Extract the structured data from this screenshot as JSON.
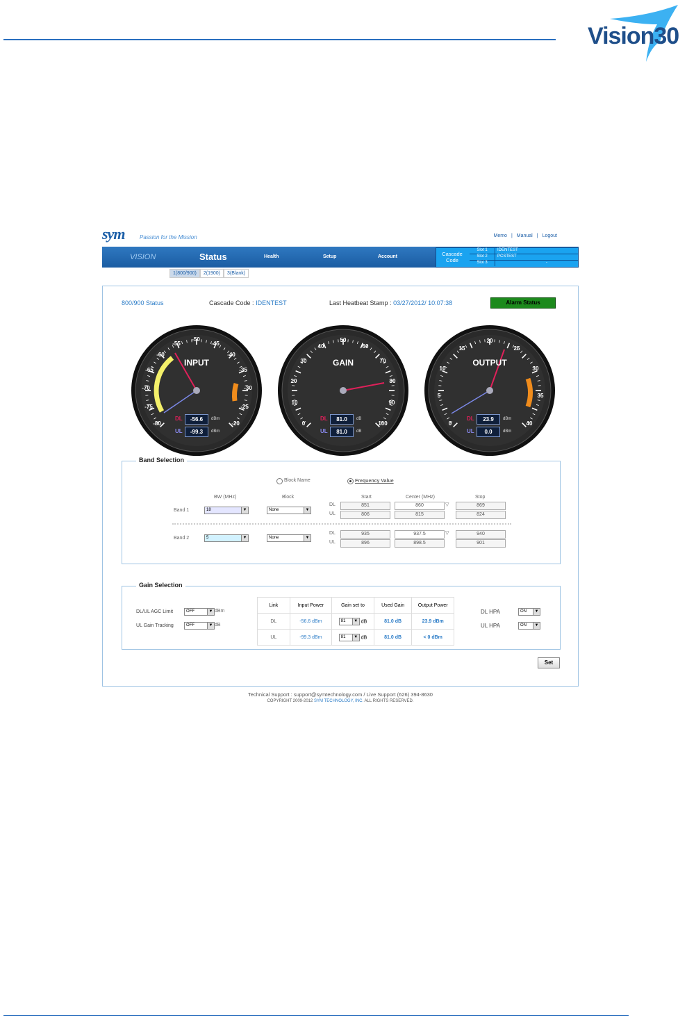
{
  "doc": {
    "logo_text": "Vision30"
  },
  "header": {
    "brand": "sym",
    "tagline": "Passion for the Mission",
    "links": [
      "Memo",
      "Manual",
      "Logout"
    ],
    "separator": "|"
  },
  "nav": {
    "vision": "VISION",
    "status": "Status",
    "items": [
      "Health",
      "Setup",
      "Account"
    ],
    "cascade_label": "Cascade Code",
    "slots": [
      {
        "label": "Slot 1",
        "value": "IDENTEST"
      },
      {
        "label": "Slot 2",
        "value": "PCSTEST"
      },
      {
        "label": "Slot 3",
        "value": "-"
      }
    ]
  },
  "subtabs": [
    "1(800/900)",
    "2(1900)",
    "3(Blank)"
  ],
  "status": {
    "title": "800/900 Status",
    "cascade_label": "Cascade Code :",
    "cascade_value": "IDENTEST",
    "heartbeat_label": "Last Heatbeat Stamp :",
    "heartbeat_value": "03/27/2012/ 10:07:38",
    "alarm_button": "Alarm Status"
  },
  "gauges": [
    {
      "title": "INPUT",
      "ticks": [
        "-80",
        "-75",
        "-70",
        "-65",
        "-60",
        "-55",
        "-50",
        "-45",
        "-40",
        "-35",
        "-30",
        "-25",
        "-20"
      ],
      "dl_label": "DL",
      "dl_value": "-56.6",
      "dl_unit": "dBm",
      "ul_label": "UL",
      "ul_value": "-99.3",
      "ul_unit": "dBm"
    },
    {
      "title": "GAIN",
      "ticks": [
        "0",
        "10",
        "20",
        "30",
        "40",
        "50",
        "60",
        "70",
        "80",
        "90",
        "100"
      ],
      "dl_label": "DL",
      "dl_value": "81.0",
      "dl_unit": "dB",
      "ul_label": "UL",
      "ul_value": "81.0",
      "ul_unit": "dB"
    },
    {
      "title": "OUTPUT",
      "ticks": [
        "0",
        "5",
        "10",
        "15",
        "20",
        "25",
        "30",
        "35",
        "40"
      ],
      "dl_label": "DL",
      "dl_value": "23.9",
      "dl_unit": "dBm",
      "ul_label": "UL",
      "ul_value": "0.0",
      "ul_unit": "dBm"
    }
  ],
  "band": {
    "legend": "Band Selection",
    "radio_block": "Block Name",
    "radio_freq": "Frequency Value",
    "col_bw": "BW (MHz)",
    "col_block": "Block",
    "col_start": "Start",
    "col_center": "Center (MHz)",
    "col_stop": "Stop",
    "dl": "DL",
    "ul": "UL",
    "rows": [
      {
        "name": "Band 1",
        "bw": "18",
        "block": "None",
        "dl_start": "851",
        "dl_center": "860",
        "dl_stop": "869",
        "ul_start": "806",
        "ul_center": "815",
        "ul_stop": "824"
      },
      {
        "name": "Band 2",
        "bw": "5",
        "block": "None",
        "dl_start": "935",
        "dl_center": "937.5",
        "dl_stop": "940",
        "ul_start": "896",
        "ul_center": "898.5",
        "ul_stop": "901"
      }
    ]
  },
  "gain": {
    "legend": "Gain Selection",
    "agc_label": "DL/UL AGC Limit",
    "agc_value": "OFF",
    "agc_unit": "dBm",
    "tracking_label": "UL Gain Tracking",
    "tracking_value": "OFF",
    "tracking_unit": "dB",
    "headers": [
      "Link",
      "Input Power",
      "Gain set to",
      "Used Gain",
      "Output Power"
    ],
    "rows": [
      {
        "link": "DL",
        "input": "-56.6 dBm",
        "gain": "81",
        "gain_unit": "dB",
        "used": "81.0 dB",
        "output": "23.9 dBm"
      },
      {
        "link": "UL",
        "input": "-99.3 dBm",
        "gain": "81",
        "gain_unit": "dB",
        "used": "81.0 dB",
        "output": "< 0 dBm"
      }
    ],
    "dl_hpa_label": "DL HPA",
    "dl_hpa_value": "ON",
    "ul_hpa_label": "UL HPA",
    "ul_hpa_value": "ON",
    "set_button": "Set"
  },
  "footer": {
    "support": "Technical Support : support@symtechnology.com / Live Support (626) 394-8630",
    "copyright_pre": "COPYRIGHT 2009-2012",
    "copyright_link": "SYM TECHNOLOGY, INC.",
    "copyright_post": "ALL RIGHTS RESERVED."
  }
}
